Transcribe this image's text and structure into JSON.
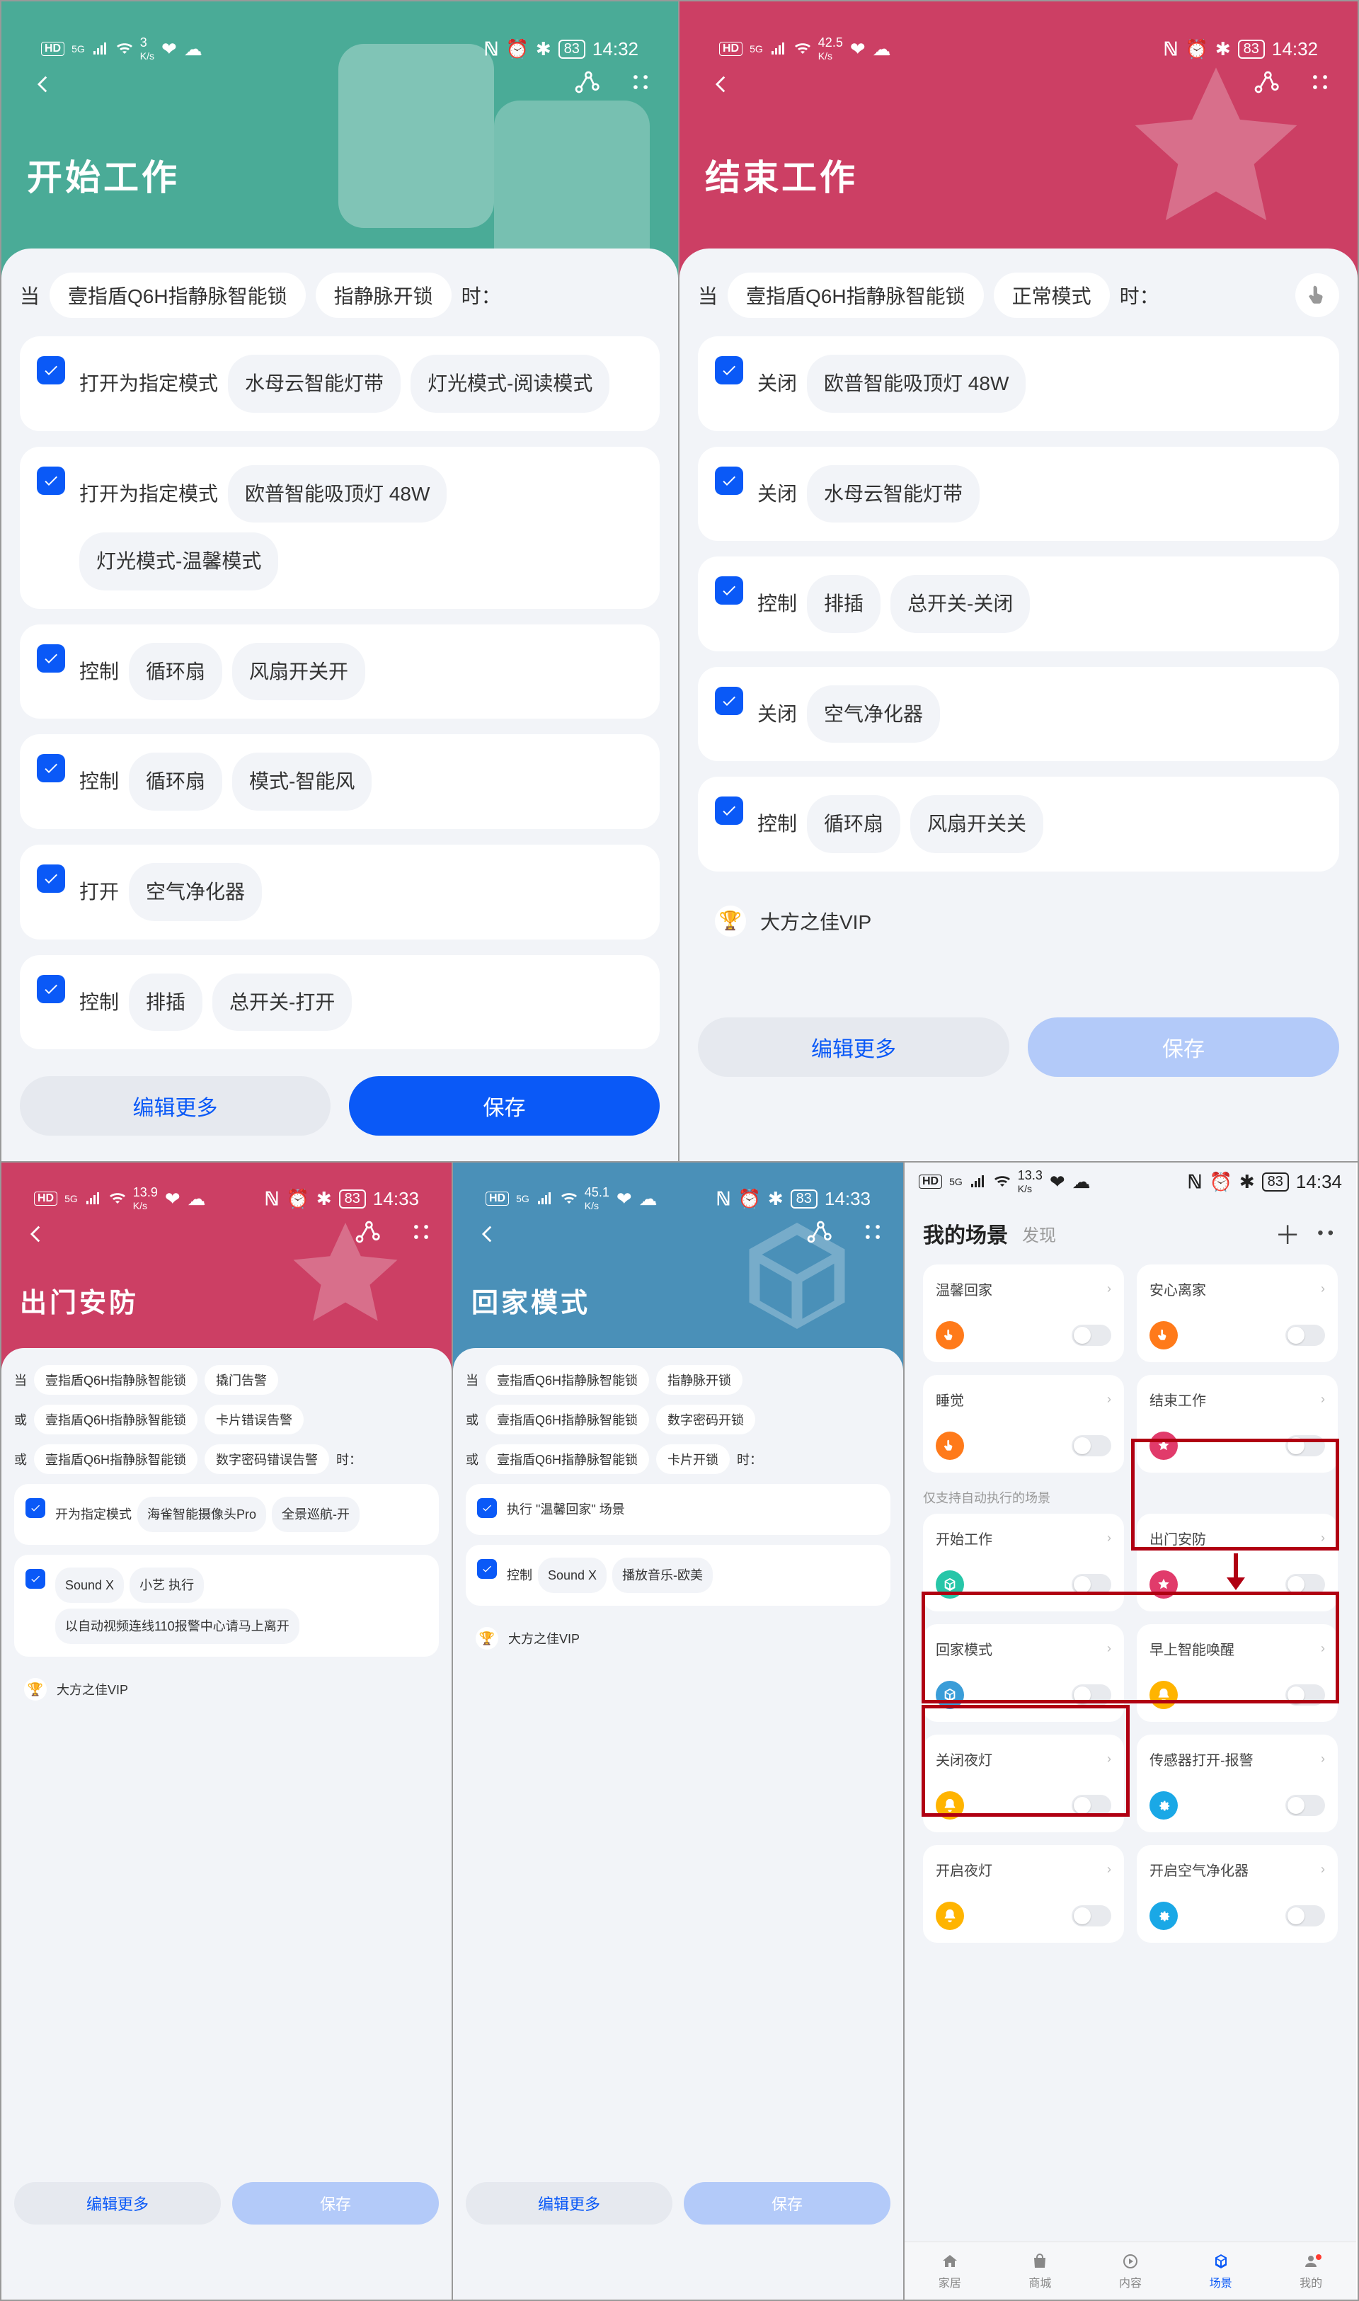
{
  "statusIcons": {
    "nfc": "ℕ",
    "alarm": "⏰",
    "bt": "✱"
  },
  "screens": [
    {
      "id": "s1",
      "kind": "scene",
      "size": "big",
      "theme": "teal",
      "status": {
        "rate": "3",
        "unit": "K/s",
        "battery": "83",
        "time": "14:32"
      },
      "title": "开始工作",
      "when_label": "当",
      "when_suffix": "时：",
      "triggers": [
        [
          "壹指盾Q6H指静脉智能锁",
          "指静脉开锁"
        ]
      ],
      "actions": [
        {
          "text": "打开为指定模式",
          "pills": [
            "水母云智能灯带",
            "灯光模式-阅读模式"
          ]
        },
        {
          "text": "打开为指定模式",
          "pills": [
            "欧普智能吸顶灯 48W",
            "灯光模式-温馨模式"
          ]
        },
        {
          "text": "控制",
          "pills": [
            "循环扇",
            "风扇开关开"
          ]
        },
        {
          "text": "控制",
          "pills": [
            "循环扇",
            "模式-智能风"
          ]
        },
        {
          "text": "打开",
          "pills": [
            "空气净化器"
          ]
        },
        {
          "text": "控制",
          "pills": [
            "排插",
            "总开关-打开"
          ]
        }
      ],
      "buttons": {
        "more": "编辑更多",
        "save": "保存",
        "save_disabled": false
      }
    },
    {
      "id": "s2",
      "kind": "scene",
      "size": "big",
      "theme": "rose",
      "status": {
        "rate": "42.5",
        "unit": "K/s",
        "battery": "83",
        "time": "14:32"
      },
      "title": "结束工作",
      "when_label": "当",
      "when_suffix": "时：",
      "touch": true,
      "triggers": [
        [
          "壹指盾Q6H指静脉智能锁",
          "正常模式"
        ]
      ],
      "actions": [
        {
          "text": "关闭",
          "pills": [
            "欧普智能吸顶灯 48W"
          ]
        },
        {
          "text": "关闭",
          "pills": [
            "水母云智能灯带"
          ]
        },
        {
          "text": "控制",
          "pills": [
            "排插",
            "总开关-关闭"
          ]
        },
        {
          "text": "关闭",
          "pills": [
            "空气净化器"
          ]
        },
        {
          "text": "控制",
          "pills": [
            "循环扇",
            "风扇开关关"
          ]
        }
      ],
      "vip": "大方之佳VIP",
      "buttons": {
        "more": "编辑更多",
        "save": "保存",
        "save_disabled": true
      }
    },
    {
      "id": "s3",
      "kind": "scene",
      "size": "sm",
      "theme": "rose",
      "status": {
        "rate": "13.9",
        "unit": "K/s",
        "battery": "83",
        "time": "14:33"
      },
      "title": "出门安防",
      "when_label": "当",
      "or_label": "或",
      "when_suffix": "时：",
      "triggers": [
        [
          "壹指盾Q6H指静脉智能锁",
          "撬门告警"
        ],
        [
          "壹指盾Q6H指静脉智能锁",
          "卡片错误告警"
        ],
        [
          "壹指盾Q6H指静脉智能锁",
          "数字密码错误告警"
        ]
      ],
      "actions": [
        {
          "text": "开为指定模式",
          "pills": [
            "海雀智能摄像头Pro",
            "全景巡航-开"
          ]
        },
        {
          "text": "",
          "pills": [
            "Sound X",
            "小艺 执行",
            "以自动视频连线110报警中心请马上离开"
          ]
        }
      ],
      "vip": "大方之佳VIP",
      "buttons": {
        "more": "编辑更多",
        "save": "保存",
        "save_disabled": true
      }
    },
    {
      "id": "s4",
      "kind": "scene",
      "size": "sm",
      "theme": "blue2",
      "status": {
        "rate": "45.1",
        "unit": "K/s",
        "battery": "83",
        "time": "14:33"
      },
      "title": "回家模式",
      "when_label": "当",
      "or_label": "或",
      "when_suffix": "时：",
      "triggers": [
        [
          "壹指盾Q6H指静脉智能锁",
          "指静脉开锁"
        ],
        [
          "壹指盾Q6H指静脉智能锁",
          "数字密码开锁"
        ],
        [
          "壹指盾Q6H指静脉智能锁",
          "卡片开锁"
        ]
      ],
      "actions": [
        {
          "text": "执行 \"温馨回家\" 场景",
          "pills": []
        },
        {
          "text": "控制",
          "pills": [
            "Sound X",
            "播放音乐-欧美"
          ]
        }
      ],
      "vip": "大方之佳VIP",
      "buttons": {
        "more": "编辑更多",
        "save": "保存",
        "save_disabled": true
      }
    },
    {
      "id": "s5",
      "kind": "grid",
      "size": "sm",
      "status": {
        "rate": "13.3",
        "unit": "K/s",
        "battery": "83",
        "time": "14:34"
      },
      "header": {
        "title": "我的场景",
        "sub": "发现"
      },
      "section_label": "仅支持自动执行的场景",
      "tiles_manual": [
        {
          "name": "温馨回家",
          "color": "#ff7a1a",
          "glyph": "hand"
        },
        {
          "name": "安心离家",
          "color": "#ff7a1a",
          "glyph": "hand"
        },
        {
          "name": "睡觉",
          "color": "#ff7a1a",
          "glyph": "hand"
        },
        {
          "name": "结束工作",
          "color": "#e13b6b",
          "glyph": "star",
          "mark": true
        }
      ],
      "tiles_auto": [
        {
          "name": "开始工作",
          "color": "#27c6a8",
          "glyph": "cube",
          "mark": true
        },
        {
          "name": "出门安防",
          "color": "#e13b6b",
          "glyph": "star",
          "mark": true
        },
        {
          "name": "回家模式",
          "color": "#3a9dd8",
          "glyph": "cube",
          "mark": true
        },
        {
          "name": "早上智能唤醒",
          "color": "#ffb400",
          "glyph": "bell"
        },
        {
          "name": "关闭夜灯",
          "color": "#ffb400",
          "glyph": "bell"
        },
        {
          "name": "传感器打开-报警",
          "color": "#1aa8e6",
          "glyph": "gear"
        },
        {
          "name": "开启夜灯",
          "color": "#ffb400",
          "glyph": "bell"
        },
        {
          "name": "开启空气净化器",
          "color": "#1aa8e6",
          "glyph": "gear"
        }
      ],
      "tabs": [
        {
          "label": "家居",
          "glyph": "home"
        },
        {
          "label": "商城",
          "glyph": "bag"
        },
        {
          "label": "内容",
          "glyph": "play"
        },
        {
          "label": "场景",
          "glyph": "cube",
          "active": true
        },
        {
          "label": "我的",
          "glyph": "user",
          "dot": true
        }
      ]
    }
  ]
}
